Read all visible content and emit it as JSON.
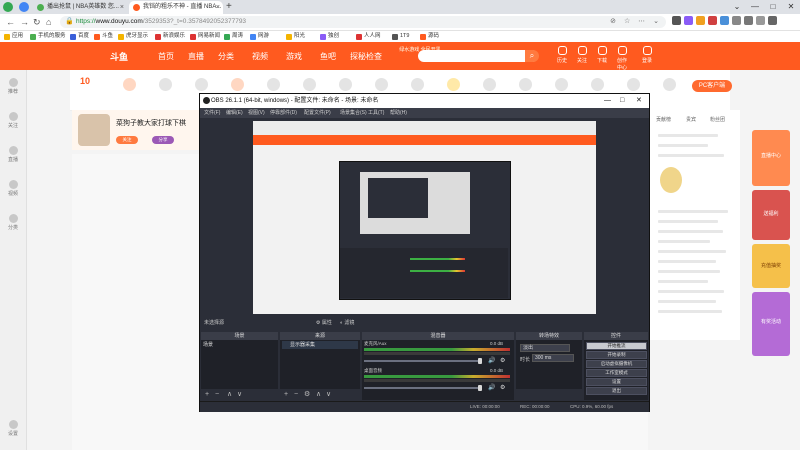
{
  "browser": {
    "tabs": [
      {
        "label": "播出抢鼠 | NBA英雄数 您..."
      },
      {
        "label": "我铛的粗乐不神 - 直播 NBA..."
      }
    ],
    "url": {
      "protocol": "https://",
      "host": "www.douyu.com",
      "path": "/3529353?_t=0.3578492052377793"
    },
    "bookmarks": [
      "应用",
      "手机的服务",
      "百度",
      "斗鱼",
      "虎牙显示",
      "新浪娱乐",
      "网易新闻",
      "周涛",
      "网游",
      "阳光",
      "独创",
      "人人网",
      "1T9",
      "源码"
    ],
    "colors": {
      "tabbar": "#dee1e6",
      "accent": "#ff5a1f"
    }
  },
  "douyu": {
    "logo": "斗鱼",
    "nav": [
      "首页",
      "直播",
      "分类",
      "视频",
      "游戏",
      "鱼吧",
      "探秘检查"
    ],
    "promo": "绿水游戏 全民开黑",
    "top_icons": [
      "历史",
      "关注",
      "下载",
      "创作中心",
      "登录"
    ],
    "left_bar": [
      "推荐",
      "关注",
      "直播",
      "视频",
      "分类",
      "设置"
    ],
    "gift_count": "10",
    "recharge": "PC客户端",
    "stream_title": "菜狗子教大家打球下棋",
    "tags": [
      "关注",
      "分享"
    ],
    "right_tabs": [
      "贡献榜",
      "贵宾",
      "粉丝团"
    ],
    "ad_texts": [
      "直播中心",
      "送福利",
      "充值抽奖",
      "有奖活动"
    ]
  },
  "obs": {
    "title": "OBS 26.1.1 (64-bit, windows) - 配置文件: 未命名 - 场景: 未命名",
    "menu": [
      "文件(F)",
      "编辑(E)",
      "视图(V)",
      "停靠部件(D)",
      "配置文件(P)",
      "场景集合(S)",
      "工具(T)",
      "帮助(H)"
    ],
    "toolbar_label": "未选择源",
    "toolbar_buttons": [
      "属性",
      "滤镜"
    ],
    "docks": {
      "scenes": {
        "title": "场景",
        "items": [
          "场景"
        ]
      },
      "sources": {
        "title": "来源",
        "items": [
          "显示器采集"
        ]
      },
      "mixer": {
        "title": "混音器",
        "channels": [
          {
            "name": "麦克风/Aux",
            "db": "0.0 dB"
          },
          {
            "name": "桌面音频",
            "db": "0.0 dB"
          }
        ],
        "scale": [
          "-60",
          "-55",
          "-50",
          "-45",
          "-40",
          "-35",
          "-30",
          "-25",
          "-20",
          "-15",
          "-10",
          "-5",
          "0"
        ]
      },
      "transitions": {
        "title": "转场特效",
        "type": "淡出",
        "duration_label": "时长",
        "duration": "300 ms"
      },
      "controls": {
        "title": "控件",
        "buttons": [
          "开始推流",
          "开始录制",
          "启动虚拟摄像机",
          "工作室模式",
          "设置",
          "退出"
        ]
      }
    },
    "status": {
      "live": "LIVE: 00:00:00",
      "rec": "REC: 00:00:00",
      "cpu": "CPU: 0.9%, 60.00 fps"
    },
    "colors": {
      "bg": "#2b2e38",
      "panel": "#1f2128",
      "meter_green": "#3cb043",
      "meter_red": "#d33"
    }
  }
}
